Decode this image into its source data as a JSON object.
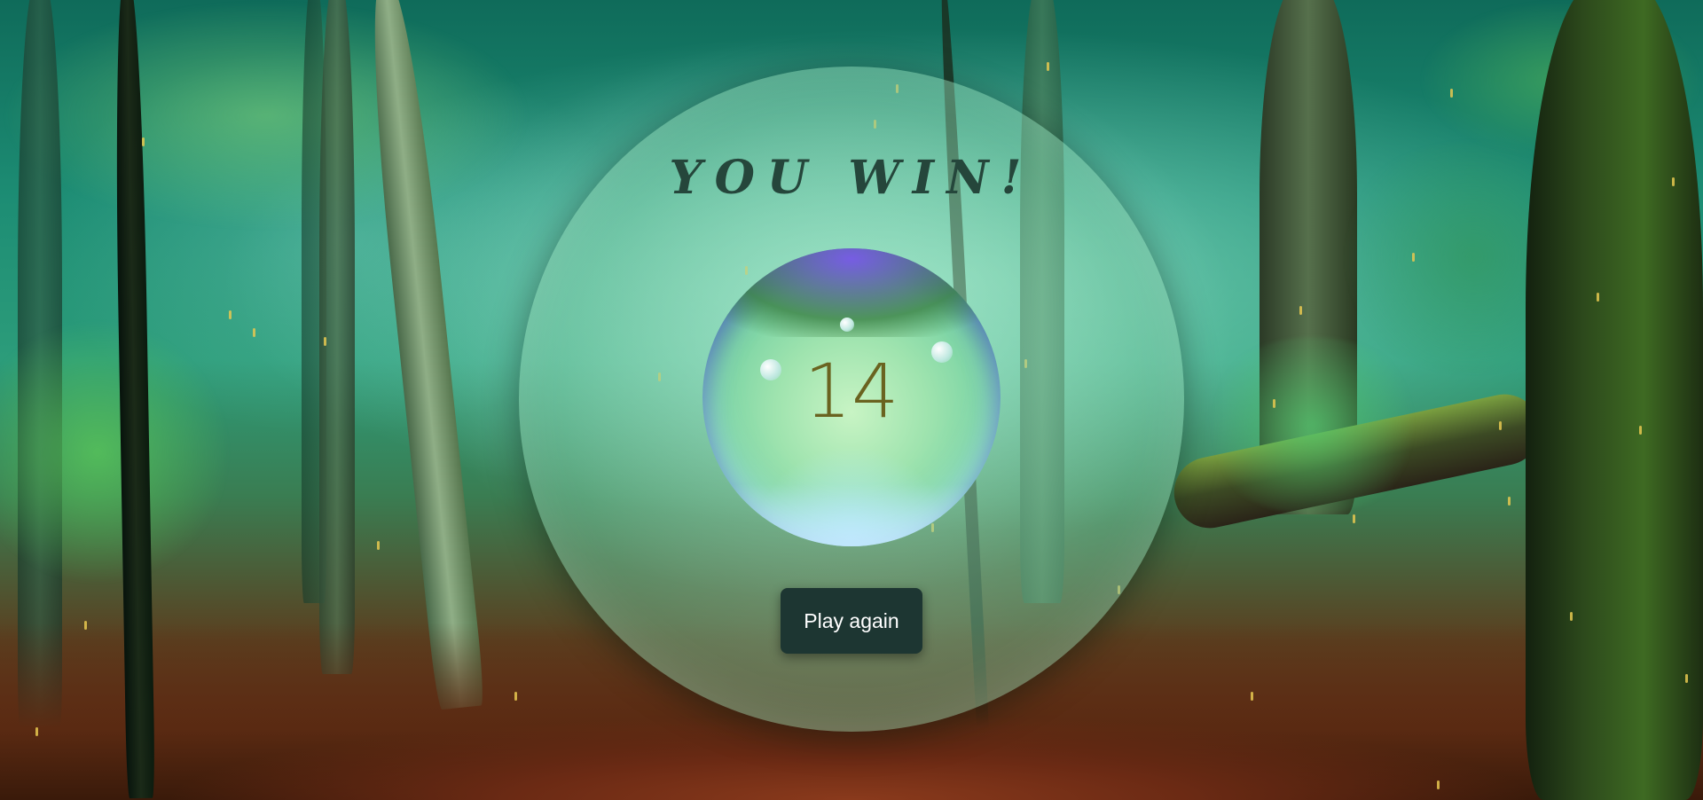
{
  "game": {
    "title": "YOU WIN!",
    "score": "14",
    "play_again_label": "Play again"
  },
  "colors": {
    "title_color": "#25463b",
    "score_color": "#6a6320",
    "button_bg": "#1d3632",
    "button_text": "#ffffff"
  },
  "background": {
    "scene": "misty-forest",
    "effect": "falling-raindrops"
  }
}
